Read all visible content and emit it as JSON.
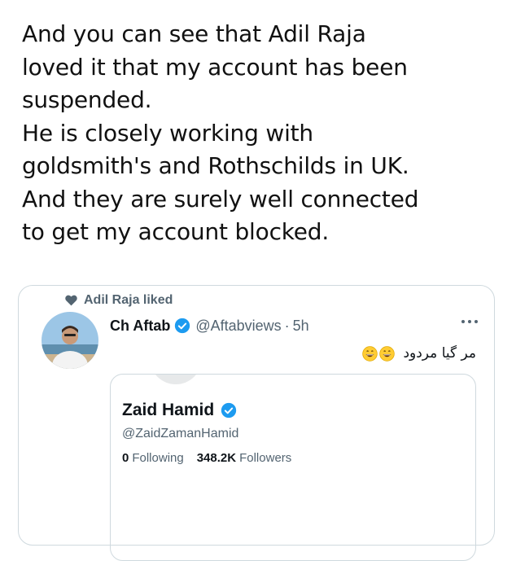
{
  "post": {
    "text": "And you can see that Adil Raja\nloved it  that my account has been\nsuspended.\nHe is closely working with\ngoldsmith's and Rothschilds in UK.\nAnd they are surely well connected\nto get my account blocked."
  },
  "embedded_tweet": {
    "liked_by": "Adil Raja liked",
    "author_name": "Ch Aftab",
    "author_handle": "@Aftabviews",
    "separator": "·",
    "time": "5h",
    "body_text": "مر گیا مردود",
    "body_emojis": [
      "grinning-face-icon",
      "grinning-face-icon"
    ],
    "quoted_profile": {
      "name": "Zaid Hamid",
      "handle": "@ZaidZamanHamid",
      "following_count": "0",
      "following_label": "Following",
      "followers_count": "348.2K",
      "followers_label": "Followers"
    }
  },
  "colors": {
    "text": "#0f1419",
    "secondary": "#536471",
    "verified": "#1d9bf0",
    "border": "#cfd9de"
  }
}
